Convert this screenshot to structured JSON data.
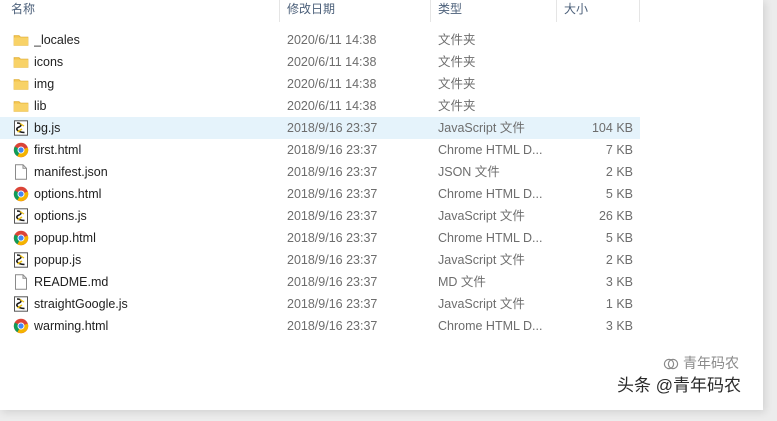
{
  "columns": {
    "name": "名称",
    "date": "修改日期",
    "type": "类型",
    "size": "大小"
  },
  "files": [
    {
      "name": "_locales",
      "date": "2020/6/11 14:38",
      "type": "文件夹",
      "size": "",
      "icon": "folder"
    },
    {
      "name": "icons",
      "date": "2020/6/11 14:38",
      "type": "文件夹",
      "size": "",
      "icon": "folder"
    },
    {
      "name": "img",
      "date": "2020/6/11 14:38",
      "type": "文件夹",
      "size": "",
      "icon": "folder"
    },
    {
      "name": "lib",
      "date": "2020/6/11 14:38",
      "type": "文件夹",
      "size": "",
      "icon": "folder"
    },
    {
      "name": "bg.js",
      "date": "2018/9/16 23:37",
      "type": "JavaScript 文件",
      "size": "104 KB",
      "icon": "js",
      "selected": true
    },
    {
      "name": "first.html",
      "date": "2018/9/16 23:37",
      "type": "Chrome HTML D...",
      "size": "7 KB",
      "icon": "chrome"
    },
    {
      "name": "manifest.json",
      "date": "2018/9/16 23:37",
      "type": "JSON 文件",
      "size": "2 KB",
      "icon": "file"
    },
    {
      "name": "options.html",
      "date": "2018/9/16 23:37",
      "type": "Chrome HTML D...",
      "size": "5 KB",
      "icon": "chrome"
    },
    {
      "name": "options.js",
      "date": "2018/9/16 23:37",
      "type": "JavaScript 文件",
      "size": "26 KB",
      "icon": "js"
    },
    {
      "name": "popup.html",
      "date": "2018/9/16 23:37",
      "type": "Chrome HTML D...",
      "size": "5 KB",
      "icon": "chrome"
    },
    {
      "name": "popup.js",
      "date": "2018/9/16 23:37",
      "type": "JavaScript 文件",
      "size": "2 KB",
      "icon": "js"
    },
    {
      "name": "README.md",
      "date": "2018/9/16 23:37",
      "type": "MD 文件",
      "size": "3 KB",
      "icon": "file"
    },
    {
      "name": "straightGoogle.js",
      "date": "2018/9/16 23:37",
      "type": "JavaScript 文件",
      "size": "1 KB",
      "icon": "js"
    },
    {
      "name": "warming.html",
      "date": "2018/9/16 23:37",
      "type": "Chrome HTML D...",
      "size": "3 KB",
      "icon": "chrome"
    }
  ],
  "watermark": {
    "top": "青年码农",
    "bottom": "头条 @青年码农"
  },
  "colors": {
    "selected_row": "#e5f3fb",
    "header_text": "#4c607a",
    "folder": "#f3c44e",
    "chrome_red": "#db4437",
    "chrome_green": "#0f9d58",
    "chrome_yellow": "#f4b400",
    "chrome_blue": "#4285f4"
  }
}
